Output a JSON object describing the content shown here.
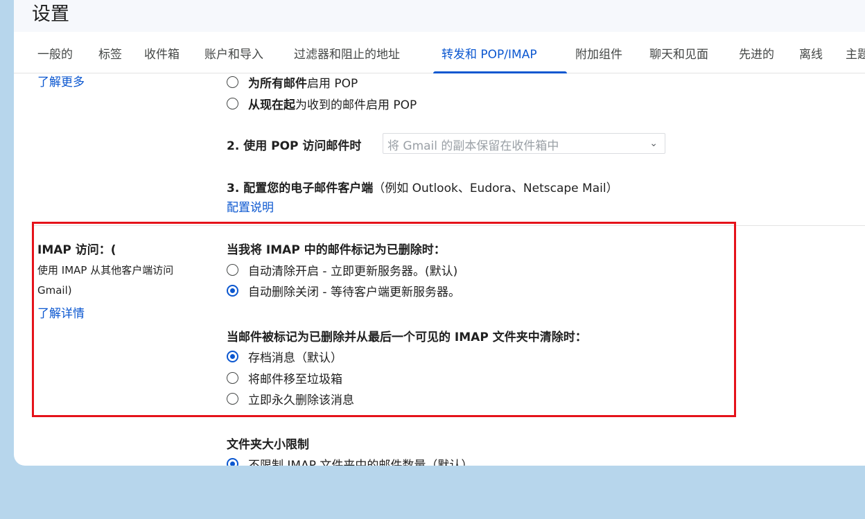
{
  "page_title": "设置",
  "tabs": [
    {
      "label": "一般的"
    },
    {
      "label": "标签"
    },
    {
      "label": "收件箱"
    },
    {
      "label": "账户和导入"
    },
    {
      "label": "过滤器和阻止的地址"
    },
    {
      "label": "转发和 POP/IMAP",
      "active": true
    },
    {
      "label": "附加组件"
    },
    {
      "label": "聊天和见面"
    },
    {
      "label": "先进的"
    },
    {
      "label": "离线"
    },
    {
      "label": "主题"
    }
  ],
  "pop": {
    "learn_more": "了解更多",
    "option_all_bold": "为所有邮件",
    "option_all_rest": "启用 POP",
    "option_now_bold": "从现在起",
    "option_now_rest": "为收到的邮件启用 POP",
    "step2_label": "2. 使用 POP 访问邮件时",
    "step2_select": "将 Gmail 的副本保留在收件箱中",
    "step3_bold": "3. 配置您的电子邮件客户端",
    "step3_rest": "（例如 Outlook、Eudora、Netscape Mail）",
    "config_link": "配置说明"
  },
  "imap": {
    "title": "IMAP 访问：(",
    "desc_line1": "使用 IMAP 从其他客户端访问",
    "desc_line2": "Gmail)",
    "learn_more": "了解详情",
    "deleted_heading": "当我将 IMAP 中的邮件标记为已删除时：",
    "auto_expunge_on": "自动清除开启 - 立即更新服务器。(默认)",
    "auto_expunge_off": "自动删除关闭 - 等待客户端更新服务器。",
    "expunged_heading": "当邮件被标记为已删除并从最后一个可见的 IMAP 文件夹中清除时：",
    "archive": "存档消息（默认）",
    "move_trash": "将邮件移至垃圾箱",
    "delete_forever": "立即永久删除该消息"
  },
  "folder_limit": {
    "heading": "文件夹大小限制",
    "no_limit": "不限制 IMAP 文件夹中的邮件数量（默认）"
  },
  "colors": {
    "accent": "#0b57d0",
    "highlight": "#e5121a",
    "background": "#b7d6ec"
  }
}
